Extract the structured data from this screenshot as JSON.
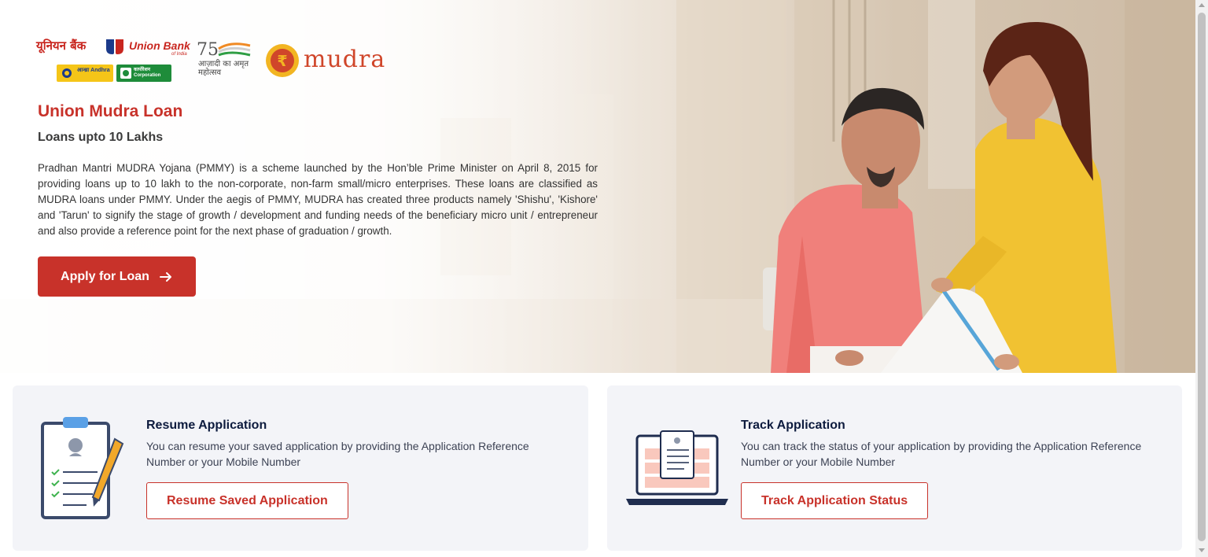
{
  "brand": {
    "ubi_hindi": "यूनियन बैंक",
    "ubi_english": "Union Bank",
    "ubi_sub": "of India",
    "andhra_label": "आन्ध्रा Andhra",
    "corporation_label": "कार्पोरेशन Corporation",
    "azadi_text": "आज़ादी का अमृत महोत्सव",
    "azadi_number": "75",
    "mudra_text": "mudra"
  },
  "hero": {
    "title": "Union Mudra Loan",
    "subtitle": "Loans upto 10 Lakhs",
    "description": "Pradhan Mantri MUDRA Yojana (PMMY) is a scheme launched by the Hon’ble Prime Minister on April 8, 2015 for providing loans up to 10 lakh to the non-corporate, non-farm small/micro enterprises. These loans are classified as MUDRA loans under PMMY. Under the aegis of PMMY, MUDRA has created three products namely 'Shishu', 'Kishore' and 'Tarun' to signify the stage of growth / development and funding needs of the beneficiary micro unit / entrepreneur and also provide a reference point for the next phase of graduation / growth.",
    "apply_label": "Apply for Loan"
  },
  "cards": {
    "resume": {
      "title": "Resume Application",
      "description": "You can resume your saved application by providing the Application Reference Number or your Mobile Number",
      "button_label": "Resume Saved Application"
    },
    "track": {
      "title": "Track Application",
      "description": "You can track the status of your application by providing the Application Reference Number or your Mobile Number",
      "button_label": "Track Application Status"
    }
  },
  "colors": {
    "brand_red": "#c8322a",
    "navy": "#0d1b3e",
    "card_bg": "#f3f4f8"
  }
}
